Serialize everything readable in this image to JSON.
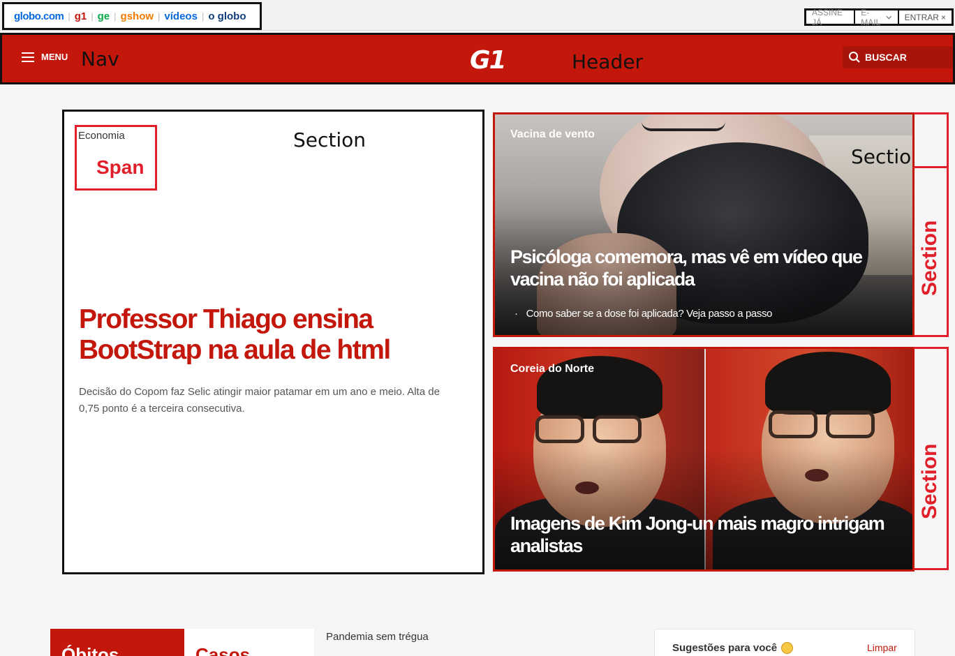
{
  "topbar": {
    "brands": [
      {
        "label": "globo.com",
        "color": "#0669de"
      },
      {
        "label": "g1",
        "color": "#c4170c"
      },
      {
        "label": "ge",
        "color": "#06aa48"
      },
      {
        "label": "gshow",
        "color": "#f47b00"
      },
      {
        "label": "vídeos",
        "color": "#0669de"
      },
      {
        "label": "o globo",
        "color": "#103e7d"
      }
    ],
    "account": {
      "subscribe": "ASSINE JÁ",
      "email": "E-MAIL",
      "login": "ENTRAR"
    }
  },
  "header": {
    "menu_label": "MENU",
    "nav_annotation": "Nav",
    "logo": "G1",
    "header_annotation": "Header",
    "search_label": "BUSCAR"
  },
  "main_story": {
    "section_label": "Economia",
    "span_annotation": "Span",
    "section_annotation": "Section",
    "headline": "Professor Thiago ensina BootStrap na aula de html",
    "summary": "Decisão do Copom faz Selic atingir maior patamar em um ano e meio. Alta de 0,75 ponto é a terceira consecutiva."
  },
  "side_stories": [
    {
      "kicker": "Vacina de vento",
      "title": "Psicóloga comemora, mas vê em vídeo que vacina não foi aplicada",
      "related": "Como saber se a dose foi aplicada? Veja passo a passo",
      "section_annotation": "Section",
      "vertical_annotation": "Section"
    },
    {
      "kicker": "Coreia do Norte",
      "title": "Imagens de Kim Jong-un mais magro intrigam analistas",
      "vertical_annotation": "Section"
    }
  ],
  "bottom": {
    "widget_deaths": "Óbitos",
    "widget_cases": "Casos",
    "pandemia_label": "Pandemia sem trégua",
    "suggestions_title": "Sugestões para você",
    "clear_label": "Limpar"
  },
  "colors": {
    "brand_red": "#c4170c",
    "annotation_red": "#e01f2a"
  }
}
